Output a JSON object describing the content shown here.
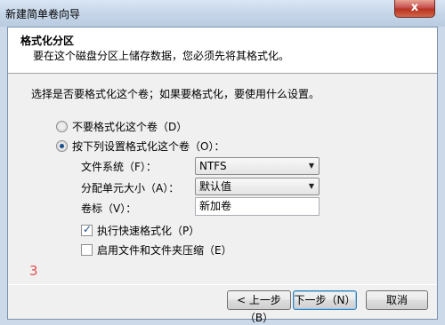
{
  "window": {
    "title": "新建简单卷向导",
    "close_glyph": "x"
  },
  "header": {
    "title": "格式化分区",
    "subtitle": "要在这个磁盘分区上储存数据，您必须先将其格式化。"
  },
  "body": {
    "question": "选择是否要格式化这个卷；如果要格式化，要使用什么设置。",
    "options": {
      "no_format": {
        "label": "不要格式化这个卷（D）",
        "selected": false
      },
      "format": {
        "label": "按下列设置格式化这个卷（O）：",
        "selected": true
      }
    },
    "file_system": {
      "label": "文件系统（F）：",
      "value": "NTFS"
    },
    "allocation_unit": {
      "label": "分配单元大小（A）：",
      "value": "默认值"
    },
    "volume_label": {
      "label": "卷标（V）：",
      "value": "新加卷"
    },
    "quick_format": {
      "label": "执行快速格式化（P）",
      "checked": true
    },
    "compression": {
      "label": "启用文件和文件夹压缩（E）",
      "checked": false
    },
    "step_annotation": "3"
  },
  "footer": {
    "back": "< 上一步（B）",
    "next": "下一步（N）",
    "cancel": "取消"
  },
  "colors": {
    "accent": "#1d4e8c",
    "annotation": "#e05050"
  }
}
